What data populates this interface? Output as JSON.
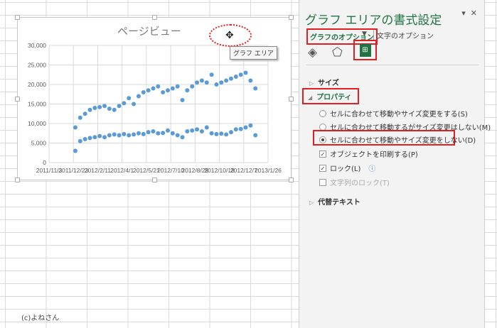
{
  "chart": {
    "tooltip": "グラフ エリア"
  },
  "chart_data": {
    "type": "scatter",
    "title": "ページビュー",
    "ylim": [
      0,
      30000
    ],
    "yticks": [
      "30,000",
      "25,000",
      "20,000",
      "15,000",
      "10,000",
      "5,000",
      "0"
    ],
    "xlim": [
      "2011-11-03",
      "2013-01-26"
    ],
    "xticks": [
      "2011/11/3",
      "2011/12/23",
      "2012/2/11",
      "2012/4/1",
      "2012/5/21",
      "2012/7/10",
      "2012/8/29",
      "2012/10/18",
      "2012/12/7",
      "2013/1/26"
    ],
    "grid": true,
    "color": "#5b9bd5",
    "x": [
      "2011-12-27",
      "2012-01-06",
      "2012-01-16",
      "2012-01-26",
      "2012-02-05",
      "2012-02-15",
      "2012-02-25",
      "2012-03-06",
      "2012-03-16",
      "2012-03-26",
      "2012-04-05",
      "2012-04-15",
      "2012-04-25",
      "2012-05-05",
      "2012-05-15",
      "2012-05-25",
      "2012-06-04",
      "2012-06-14",
      "2012-06-24",
      "2012-07-04",
      "2012-07-14",
      "2012-07-24",
      "2012-08-03",
      "2012-08-13",
      "2012-08-23",
      "2012-09-02",
      "2012-09-12",
      "2012-09-22",
      "2012-10-02",
      "2012-10-12",
      "2012-10-22",
      "2012-11-01",
      "2012-11-11",
      "2012-11-21",
      "2012-12-01",
      "2012-12-11",
      "2012-12-21",
      "2012-12-31"
    ],
    "series": [
      {
        "values": [
          9000,
          11500,
          12500,
          13500,
          14000,
          14200,
          14500,
          13800,
          13500,
          14500,
          15200,
          16500,
          15000,
          17000,
          18000,
          18500,
          19000,
          19500,
          18000,
          18500,
          19000,
          19500,
          16000,
          18500,
          19500,
          20500,
          21000,
          20500,
          22500,
          20000,
          20500,
          21000,
          21500,
          22000,
          22500,
          23000,
          21000,
          19000
        ]
      },
      {
        "values": [
          3000,
          5500,
          6000,
          6300,
          6500,
          6800,
          6500,
          7000,
          7200,
          7000,
          7300,
          7000,
          7200,
          7500,
          7300,
          7800,
          8000,
          7500,
          7600,
          8200,
          7500,
          7000,
          6500,
          8000,
          8200,
          8500,
          8000,
          9000,
          7500,
          7300,
          7400,
          7200,
          7800,
          8500,
          8600,
          9000,
          9500,
          7000
        ]
      }
    ]
  },
  "panel": {
    "title": "グラフ エリアの書式設定",
    "tab_chart_options": "グラフのオプション",
    "tab_text_options": "文字のオプション",
    "section_size": "サイズ",
    "section_properties": "プロパティ",
    "radio_move_resize": "セルに合わせて移動やサイズ変更をする(S)",
    "radio_move_only": "セルに合わせて移動するがサイズ変更はしない(M)",
    "radio_no_move": "セルに合わせて移動やサイズ変更をしない(D)",
    "print_object": "オブジェクトを印刷する(P)",
    "lock": "ロック(L)",
    "lock_text": "文字列のロック(T)",
    "section_alt_text": "代替テキスト"
  },
  "credit": "(c)よねさん"
}
